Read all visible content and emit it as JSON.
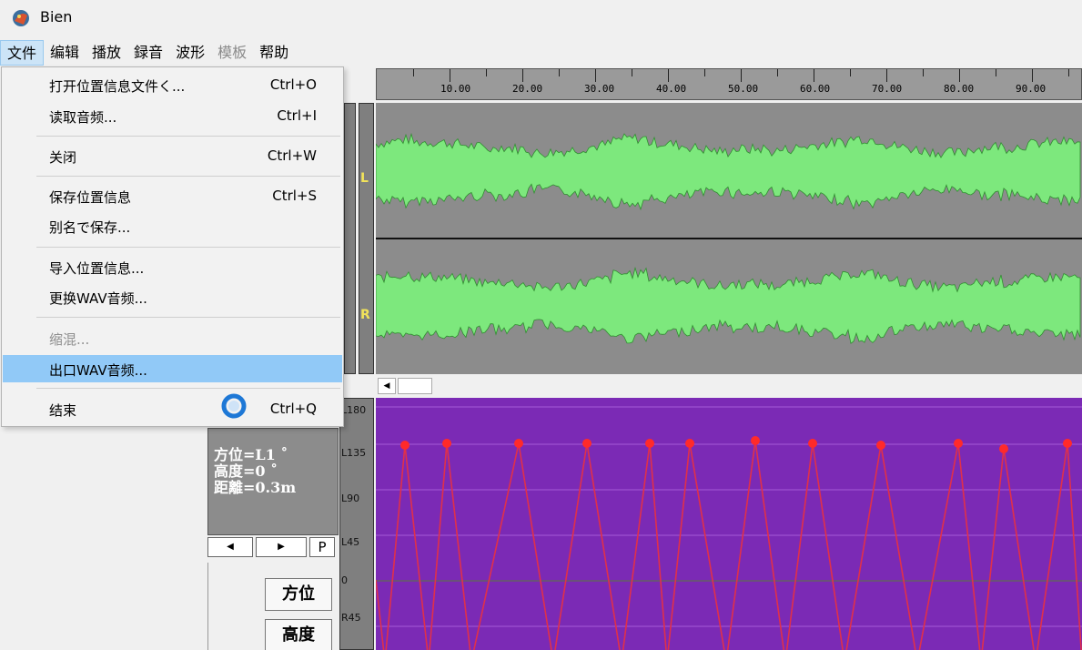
{
  "app": {
    "title": "Bien"
  },
  "menubar": [
    {
      "label": "文件",
      "state": "active"
    },
    {
      "label": "编辑",
      "state": "normal"
    },
    {
      "label": "播放",
      "state": "normal"
    },
    {
      "label": "録音",
      "state": "normal"
    },
    {
      "label": "波形",
      "state": "normal"
    },
    {
      "label": "模板",
      "state": "disabled"
    },
    {
      "label": "帮助",
      "state": "normal"
    }
  ],
  "file_menu": {
    "items": [
      {
        "label": "打开位置信息文件く...",
        "shortcut": "Ctrl+O"
      },
      {
        "label": "读取音频...",
        "shortcut": "Ctrl+I"
      },
      {
        "label": "关闭",
        "shortcut": "Ctrl+W"
      },
      {
        "label": "保存位置信息",
        "shortcut": "Ctrl+S"
      },
      {
        "label": "别名で保存...",
        "shortcut": ""
      },
      {
        "label": "导入位置信息...",
        "shortcut": ""
      },
      {
        "label": "更换WAV音频...",
        "shortcut": ""
      },
      {
        "label": "缩混...",
        "shortcut": "",
        "state": "disabled"
      },
      {
        "label": "出口WAV音频...",
        "shortcut": "",
        "state": "highlighted"
      },
      {
        "label": "结束",
        "shortcut": "Ctrl+Q"
      }
    ]
  },
  "ruler": {
    "labels": [
      "10.00",
      "20.00",
      "30.00",
      "40.00",
      "50.00",
      "60.00",
      "70.00",
      "80.00",
      "90.00"
    ]
  },
  "waveform": {
    "channels": [
      "L",
      "R"
    ],
    "color": "#7de87d"
  },
  "position_graph": {
    "y_labels": [
      "L180",
      "L135",
      "L90",
      "L45",
      "0",
      "R45"
    ],
    "background": "#7b2ab5",
    "line_color": "#ff2a2a"
  },
  "info": {
    "azimuth": "方位=L1 ˚",
    "elevation": "高度=0 ˚",
    "distance": "距離=0.3m"
  },
  "nav": {
    "prev": "◀",
    "next": "▶",
    "p_label": "P"
  },
  "buttons": {
    "azimuth": "方位",
    "elevation": "高度"
  },
  "scroll": {
    "left_arrow": "◀"
  }
}
